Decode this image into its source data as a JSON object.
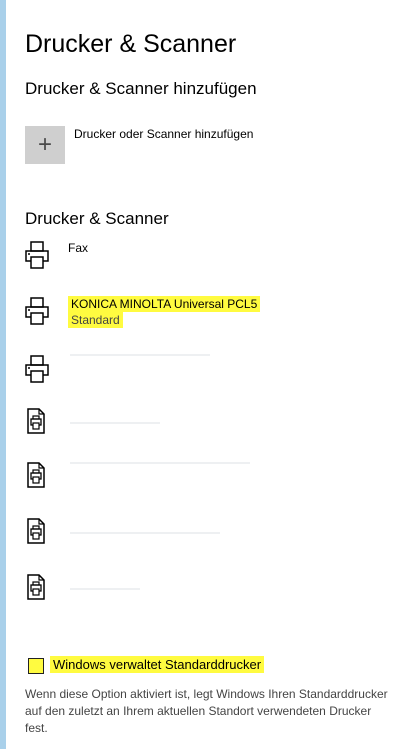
{
  "page": {
    "title": "Drucker & Scanner",
    "accent_color": "#a9d0ea",
    "highlight_color": "#fffb40"
  },
  "add_section": {
    "title": "Drucker & Scanner hinzufügen",
    "button_icon": "plus-icon",
    "button_label": "Drucker oder Scanner hinzufügen"
  },
  "printers_section": {
    "title": "Drucker & Scanner",
    "items": [
      {
        "name": "Fax",
        "status": "",
        "icon": "printer-icon"
      },
      {
        "name": "KONICA MINOLTA Universal PCL5",
        "status": "Standard",
        "icon": "printer-icon"
      },
      {
        "name": "",
        "status": "",
        "icon": "printer-icon"
      },
      {
        "name": "",
        "status": "",
        "icon": "document-printer-icon"
      },
      {
        "name": "",
        "status": "",
        "icon": "document-printer-icon"
      },
      {
        "name": "",
        "status": "",
        "icon": "document-printer-icon"
      },
      {
        "name": "",
        "status": "",
        "icon": "document-printer-icon"
      }
    ]
  },
  "default_printer_option": {
    "label": "Windows verwaltet Standarddrucker",
    "checked": false,
    "description": "Wenn diese Option aktiviert ist, legt Windows Ihren Standarddrucker auf den zuletzt an Ihrem aktuellen Standort verwendeten Drucker fest."
  }
}
